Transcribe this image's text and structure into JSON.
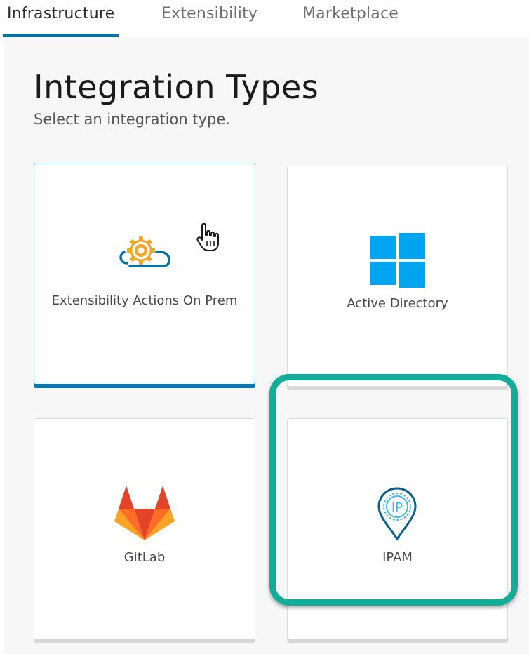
{
  "tabs": [
    {
      "label": "Infrastructure",
      "active": true
    },
    {
      "label": "Extensibility",
      "active": false
    },
    {
      "label": "Marketplace",
      "active": false
    }
  ],
  "header": {
    "title": "Integration Types",
    "subtitle": "Select an integration type."
  },
  "cards": [
    {
      "label": "Extensibility Actions On Prem",
      "icon": "gear-cloud-icon",
      "selected": true
    },
    {
      "label": "Active Directory",
      "icon": "windows-logo-icon",
      "selected": false
    },
    {
      "label": "GitLab",
      "icon": "gitlab-logo-icon",
      "selected": false
    },
    {
      "label": "IPAM",
      "icon": "ipam-pin-icon",
      "selected": false,
      "highlighted": true
    }
  ],
  "colors": {
    "accent": "#0079b8",
    "highlight": "#12ad98",
    "windows": "#00a4ef",
    "gear": "#f5a623"
  }
}
